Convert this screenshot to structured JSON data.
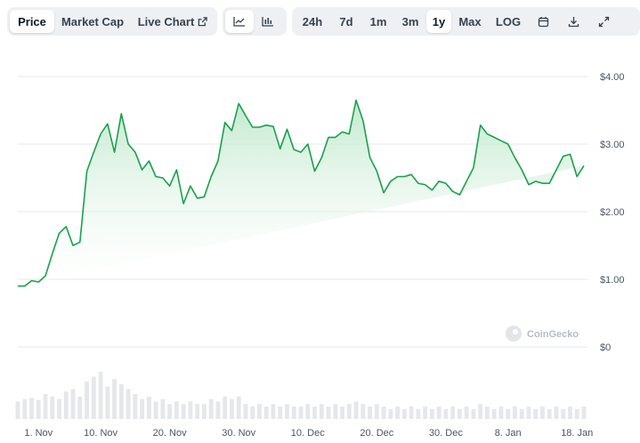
{
  "toolbar": {
    "view_tabs": [
      "Price",
      "Market Cap",
      "Live Chart"
    ],
    "active_view": "Price",
    "chart_style_icons": [
      "line-chart-icon",
      "candlestick-icon"
    ],
    "active_style": "line-chart-icon",
    "ranges": [
      "24h",
      "7d",
      "1m",
      "3m",
      "1y",
      "Max",
      "LOG"
    ],
    "active_range": "1y",
    "tool_icons": [
      "calendar-icon",
      "download-icon",
      "expand-icon"
    ]
  },
  "watermark": "CoinGecko",
  "colors": {
    "line": "#16a34a",
    "fill_top": "#bfe8cb",
    "volume": "#e5e7eb",
    "grid": "#e5e7eb",
    "active_tab_bg": "#ffffff",
    "toolbar_bg": "#eef0f3"
  },
  "chart_data": {
    "type": "area",
    "title": "",
    "xlabel": "",
    "ylabel": "",
    "ylim": [
      0,
      4
    ],
    "yticks": [
      "$0",
      "$1.00",
      "$2.00",
      "$3.00",
      "$4.00"
    ],
    "ytick_values": [
      0,
      1,
      2,
      3,
      4
    ],
    "xticks": [
      "1. Nov",
      "10. Nov",
      "20. Nov",
      "30. Nov",
      "10. Dec",
      "20. Dec",
      "30. Dec",
      "8. Jan",
      "18. Jan"
    ],
    "xtick_days": [
      3,
      12,
      22,
      32,
      42,
      52,
      62,
      71,
      81
    ],
    "grid": true,
    "x_days": [
      0,
      1,
      2,
      3,
      4,
      5,
      6,
      7,
      8,
      9,
      10,
      11,
      12,
      13,
      14,
      15,
      16,
      17,
      18,
      19,
      20,
      21,
      22,
      23,
      24,
      25,
      26,
      27,
      28,
      29,
      30,
      31,
      32,
      33,
      34,
      35,
      36,
      37,
      38,
      39,
      40,
      41,
      42,
      43,
      44,
      45,
      46,
      47,
      48,
      49,
      50,
      51,
      52,
      53,
      54,
      55,
      56,
      57,
      58,
      59,
      60,
      61,
      62,
      63,
      64,
      65,
      66,
      67,
      68,
      69,
      70,
      71,
      72,
      73,
      74,
      75,
      76,
      77,
      78,
      79,
      80,
      81,
      82
    ],
    "series": [
      {
        "values": [
          0.9,
          0.9,
          0.98,
          0.96,
          1.05,
          1.38,
          1.68,
          1.78,
          1.5,
          1.55,
          2.6,
          2.88,
          3.15,
          3.3,
          2.88,
          3.45,
          3.0,
          2.88,
          2.62,
          2.75,
          2.52,
          2.5,
          2.38,
          2.62,
          2.12,
          2.38,
          2.2,
          2.22,
          2.52,
          2.75,
          3.32,
          3.2,
          3.6,
          3.42,
          3.25,
          3.25,
          3.28,
          3.26,
          2.93,
          3.22,
          2.92,
          2.88,
          3.0,
          2.6,
          2.8,
          3.1,
          3.1,
          3.18,
          3.15,
          3.65,
          3.35,
          2.8,
          2.6,
          2.28,
          2.45,
          2.52,
          2.52,
          2.55,
          2.42,
          2.4,
          2.32,
          2.45,
          2.42,
          2.3,
          2.25,
          2.45,
          2.65,
          3.28,
          3.15,
          3.1,
          3.05,
          3.0,
          2.8,
          2.62,
          2.4,
          2.45,
          2.42,
          2.42,
          2.62,
          2.82,
          2.85,
          2.52,
          2.68,
          2.46,
          2.46
        ]
      }
    ],
    "volume": [
      0.35,
      0.4,
      0.42,
      0.38,
      0.5,
      0.45,
      0.4,
      0.55,
      0.6,
      0.45,
      0.75,
      0.85,
      0.95,
      0.65,
      0.8,
      0.7,
      0.6,
      0.5,
      0.4,
      0.45,
      0.35,
      0.4,
      0.3,
      0.35,
      0.3,
      0.35,
      0.3,
      0.3,
      0.4,
      0.35,
      0.45,
      0.4,
      0.45,
      0.3,
      0.25,
      0.3,
      0.25,
      0.3,
      0.25,
      0.3,
      0.25,
      0.25,
      0.3,
      0.25,
      0.3,
      0.25,
      0.3,
      0.25,
      0.3,
      0.35,
      0.3,
      0.25,
      0.3,
      0.25,
      0.2,
      0.25,
      0.2,
      0.25,
      0.2,
      0.25,
      0.2,
      0.25,
      0.2,
      0.25,
      0.2,
      0.25,
      0.2,
      0.3,
      0.25,
      0.2,
      0.25,
      0.2,
      0.25,
      0.2,
      0.25,
      0.2,
      0.25,
      0.2,
      0.25,
      0.2,
      0.25,
      0.2,
      0.25
    ]
  }
}
